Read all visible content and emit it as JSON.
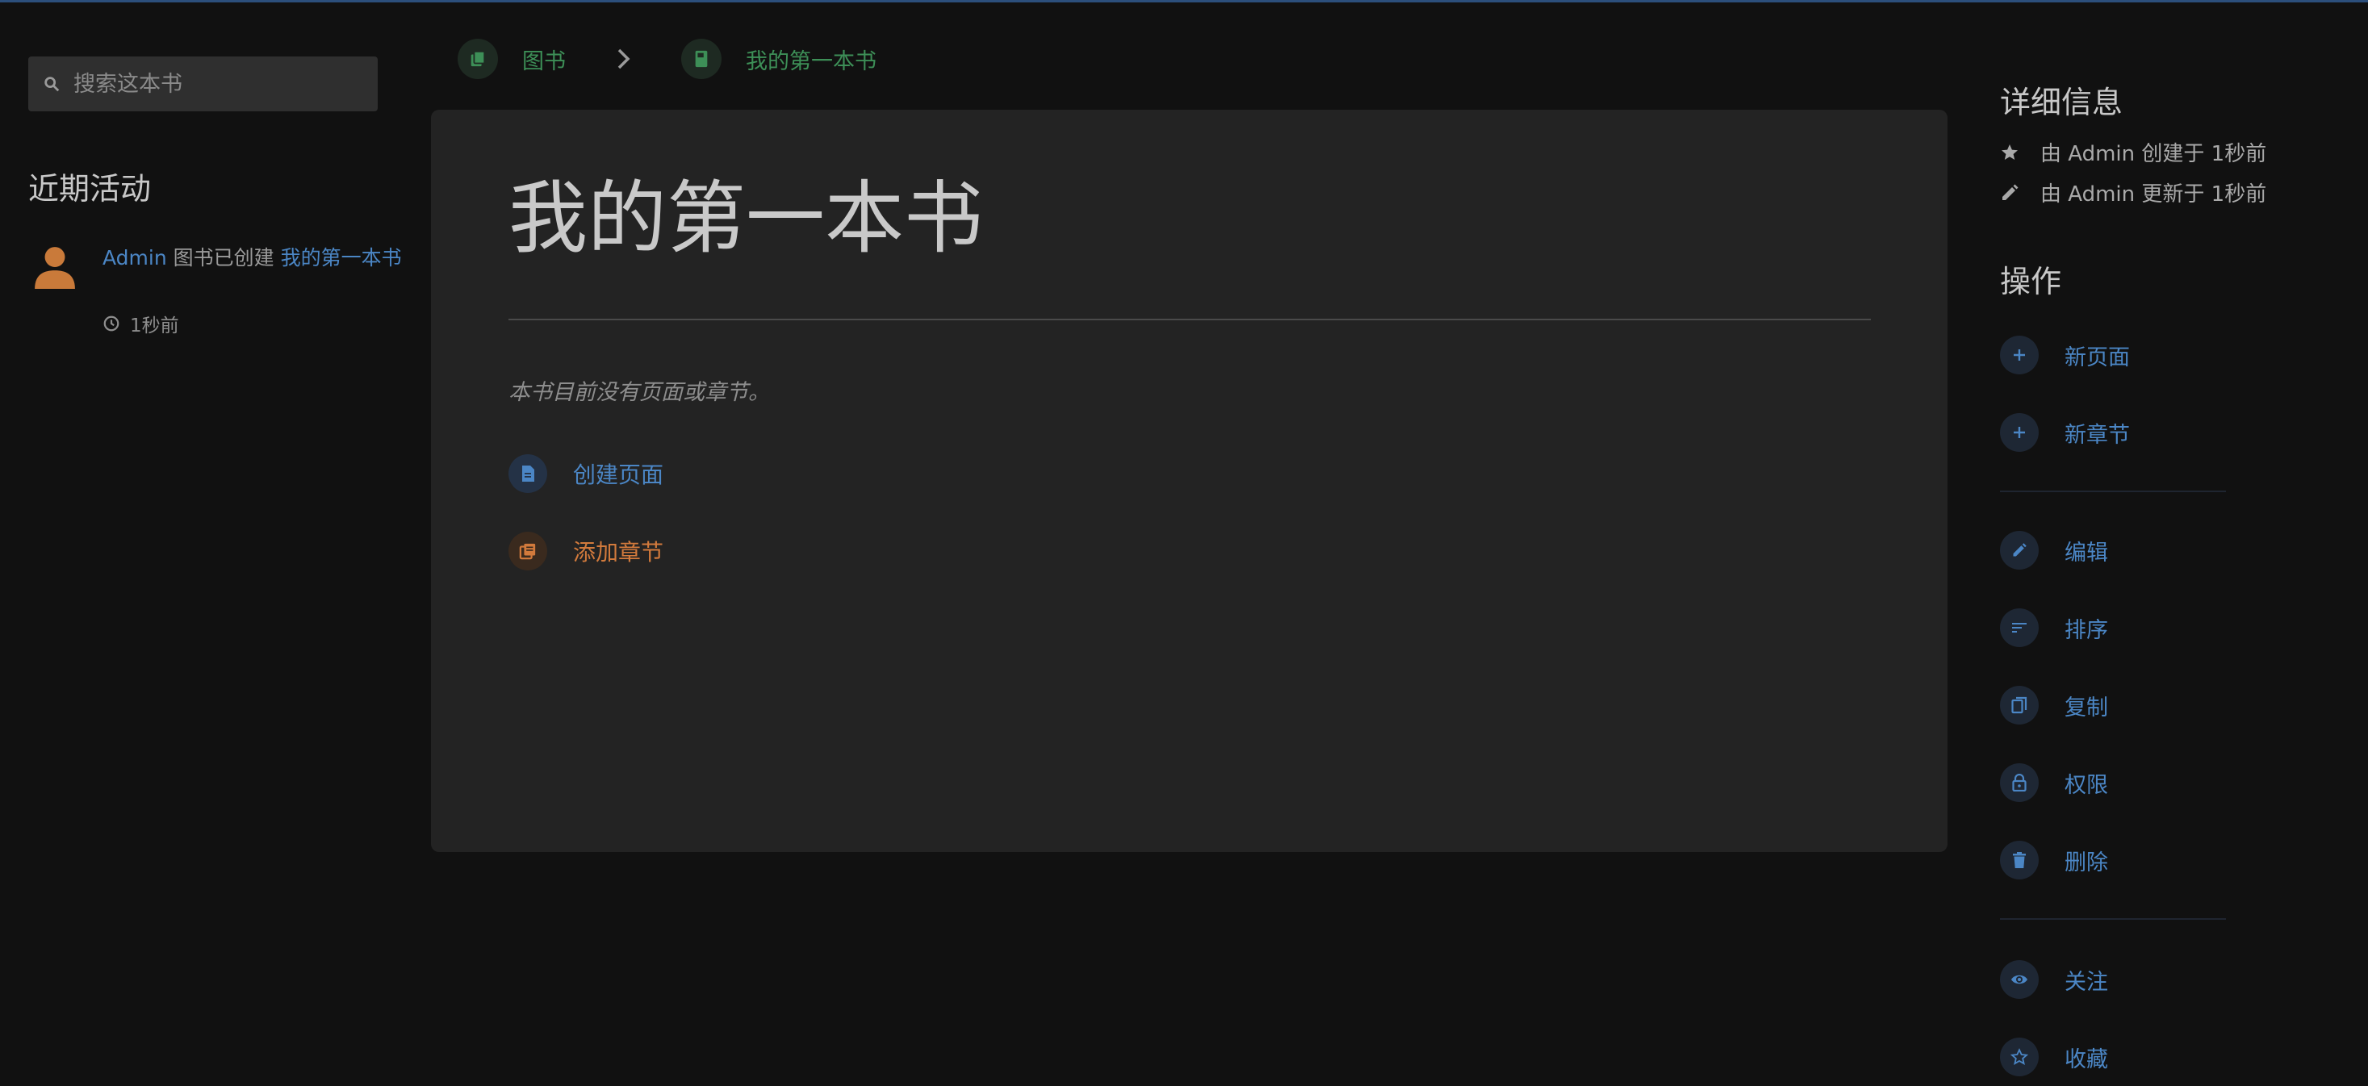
{
  "search": {
    "placeholder": "搜索这本书"
  },
  "recent": {
    "title": "近期活动",
    "items": [
      {
        "user": "Admin",
        "action": "图书已创建",
        "target": "我的第一本书",
        "time": "1秒前"
      }
    ]
  },
  "breadcrumb": {
    "items": [
      {
        "label": "图书",
        "icon": "books-icon"
      },
      {
        "label": "我的第一本书",
        "icon": "book-icon"
      }
    ]
  },
  "book": {
    "title": "我的第一本书",
    "empty_text": "本书目前没有页面或章节。",
    "create_page_label": "创建页面",
    "add_chapter_label": "添加章节"
  },
  "details": {
    "title": "详细信息",
    "created": "由 Admin 创建于 1秒前",
    "updated": "由 Admin 更新于 1秒前"
  },
  "actions": {
    "title": "操作",
    "new_page": "新页面",
    "new_chapter": "新章节",
    "edit": "编辑",
    "sort": "排序",
    "copy": "复制",
    "permissions": "权限",
    "delete": "删除",
    "watch": "关注",
    "favourite": "收藏"
  },
  "colors": {
    "background": "#111111",
    "card": "#232323",
    "link": "#4b86c5",
    "book_green": "#3d8f57",
    "chapter_orange": "#d27a3c"
  }
}
